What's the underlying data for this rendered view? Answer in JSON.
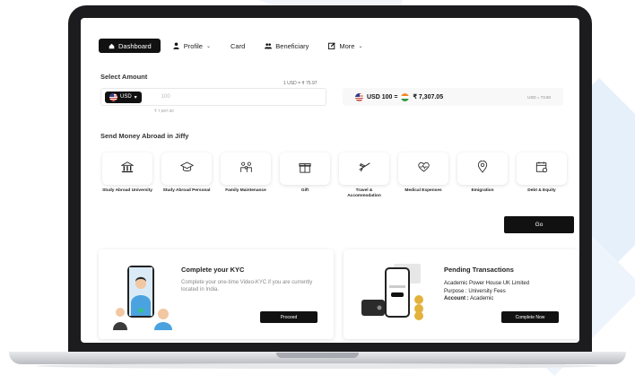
{
  "nav": {
    "items": [
      {
        "label": "Dashboard",
        "icon": "home-icon",
        "active": true
      },
      {
        "label": "Profile",
        "icon": "user-icon",
        "dropdown": true
      },
      {
        "label": "Card",
        "icon": "",
        "dropdown": false
      },
      {
        "label": "Beneficiary",
        "icon": "users-icon",
        "dropdown": false
      },
      {
        "label": "More",
        "icon": "edit-icon",
        "dropdown": true
      }
    ]
  },
  "select_amount": {
    "label": "Select Amount",
    "rate_note": "1 USD = ₹ 75.97",
    "currency": "USD",
    "input_placeholder": "100",
    "sub_value": "₹ 7,597.00"
  },
  "rate_box": {
    "base": "USD 100 =",
    "converted": "₹ 7,307.05",
    "right_note": "USD = 73.60"
  },
  "send_money": {
    "heading": "Send Money Abroad in Jiffy",
    "categories": [
      {
        "label": "Study Abroad University",
        "icon": "university-icon"
      },
      {
        "label": "Study Abroad Personal",
        "icon": "graduation-cap-icon"
      },
      {
        "label": "Family Maintenance",
        "icon": "family-icon"
      },
      {
        "label": "Gift",
        "icon": "gift-icon"
      },
      {
        "label": "Travel & Accommodation",
        "icon": "airplane-icon"
      },
      {
        "label": "Medical Expenses",
        "icon": "heart-pulse-icon"
      },
      {
        "label": "Emigration",
        "icon": "location-pin-icon"
      },
      {
        "label": "Debt & Equity",
        "icon": "calendar-icon"
      }
    ],
    "go_label": "Go"
  },
  "kyc_card": {
    "title": "Complete your KYC",
    "text": "Complete your one-time Video-KYC if you are currently located in India.",
    "button": "Proceed"
  },
  "pending_card": {
    "title": "Pending Transactions",
    "company": "Academic Power House UK Limited",
    "purpose_label": "Purpose :",
    "purpose_value": "University Fees",
    "account_label": "Account :",
    "account_value": "Academic",
    "button": "Complete Now"
  },
  "colors": {
    "primary": "#111111",
    "accent_bg": "#e6f0fa"
  }
}
